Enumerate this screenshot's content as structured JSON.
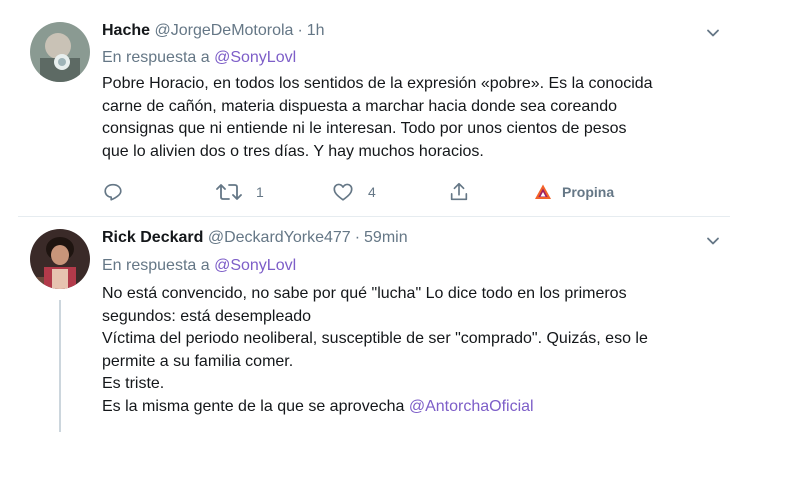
{
  "tweet1": {
    "name": "Hache",
    "handle": "@JorgeDeMotorola",
    "separator": "·",
    "time": "1h",
    "reply_prefix": "En respuesta a",
    "reply_to": "@SonyLovl",
    "lines": [
      "Pobre Horacio, en todos los sentidos de la expresión «pobre». Es la conocida",
      "carne de cañón, materia dispuesta a marchar hacia donde sea coreando",
      "consignas que ni entiende ni le interesan. Todo por unos cientos de pesos",
      "que lo alivien dos o tres días. Y hay muchos horacios."
    ],
    "actions": {
      "reply_icon": "reply-icon",
      "retweet_icon": "retweet-icon",
      "retweet_count": "1",
      "like_icon": "heart-icon",
      "like_count": "4",
      "share_icon": "share-icon",
      "tip_icon": "brave-tip-icon",
      "tip_label": "Propina"
    }
  },
  "tweet2": {
    "name": "Rick Deckard",
    "handle": "@DeckardYorke477",
    "separator": "·",
    "time": "59min",
    "reply_prefix": "En respuesta a",
    "reply_to": "@SonyLovl",
    "lines": [
      "No está convencido, no sabe por qué \"lucha\" Lo dice todo en los primeros",
      "segundos: está desempleado",
      "Víctima del periodo neoliberal, susceptible de ser \"comprado\". Quizás, eso le",
      "permite a su familia comer.",
      "Es triste.",
      "Es la misma gente de la que se aprovecha"
    ],
    "last_mention": "@AntorchaOficial"
  },
  "colors": {
    "link": "#7d5ec8",
    "muted": "#657786",
    "text": "#14171a",
    "tip_orange": "#f3622a"
  }
}
